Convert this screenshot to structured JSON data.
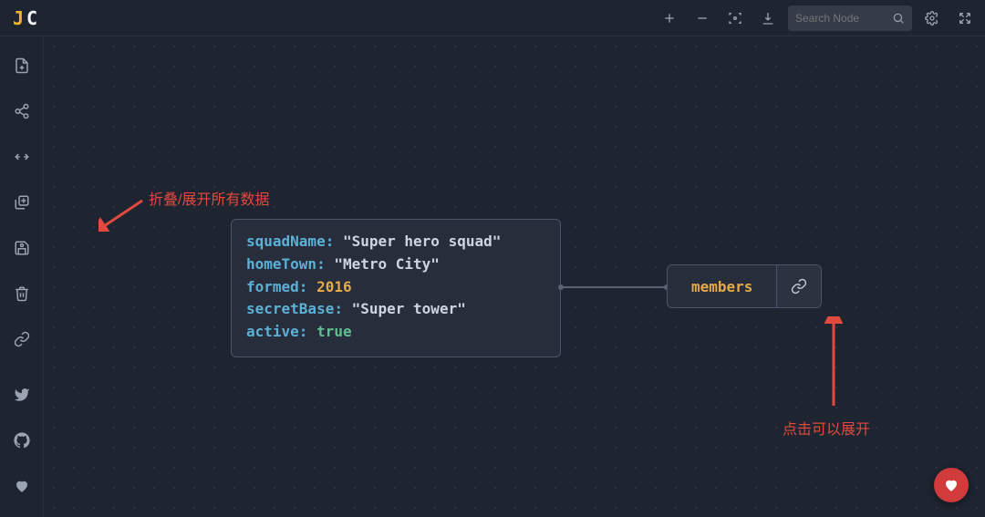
{
  "logo": {
    "left": "J",
    "right": "C"
  },
  "topbar": {
    "search_placeholder": "Search Node"
  },
  "node": {
    "squadName_key": "squadName:",
    "squadName_val": "\"Super hero squad\"",
    "homeTown_key": "homeTown:",
    "homeTown_val": "\"Metro City\"",
    "formed_key": "formed:",
    "formed_val": "2016",
    "secretBase_key": "secretBase:",
    "secretBase_val": "\"Super tower\"",
    "active_key": "active:",
    "active_val": "true"
  },
  "link_node": {
    "label": "members"
  },
  "annotations": {
    "collapse_expand": "折叠/展开所有数据",
    "click_to_expand": "点击可以展开"
  }
}
